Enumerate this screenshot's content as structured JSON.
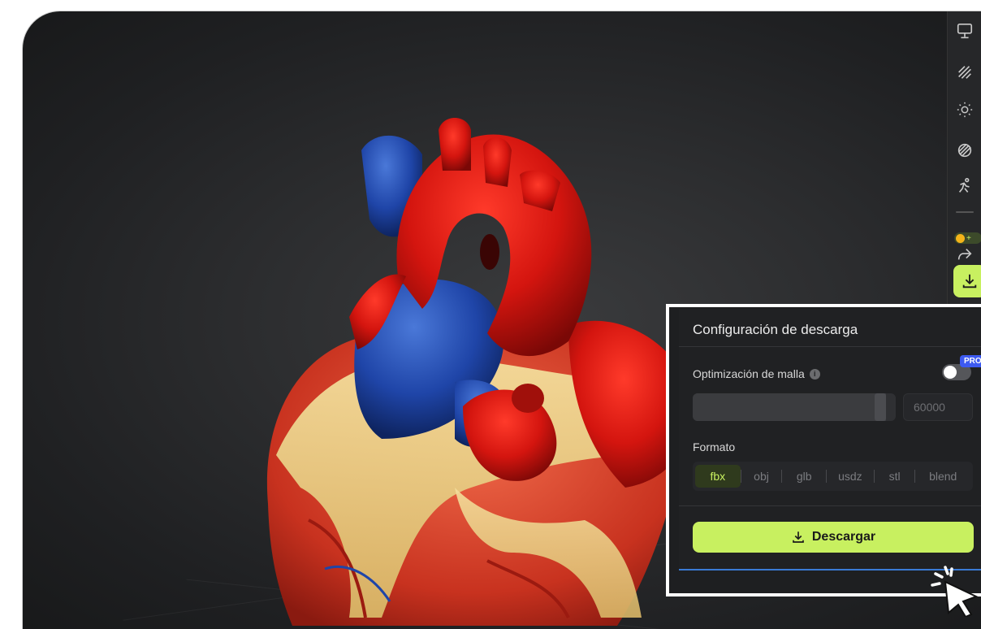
{
  "toolbar": {
    "icons": [
      "monitor-icon",
      "hatch-icon",
      "sun-icon",
      "material-icon",
      "run-animation-icon",
      "share-icon",
      "download-icon"
    ],
    "credit_badge": "+"
  },
  "panel": {
    "title": "Configuración de descarga",
    "mesh_optimization_label": "Optimización de malla",
    "info_glyph": "i",
    "pro_badge": "PRO",
    "toggle_on": false,
    "slider_fraction": 0.95,
    "poly_count_placeholder": "60000",
    "format_label": "Formato",
    "formats": [
      "fbx",
      "obj",
      "glb",
      "usdz",
      "stl",
      "blend"
    ],
    "selected_format": "fbx",
    "download_label": "Descargar"
  },
  "colors": {
    "accent": "#c8f060",
    "panel_bg": "#202123",
    "viewport_bg": "#2c2d2f",
    "pro": "#3d5af1"
  }
}
